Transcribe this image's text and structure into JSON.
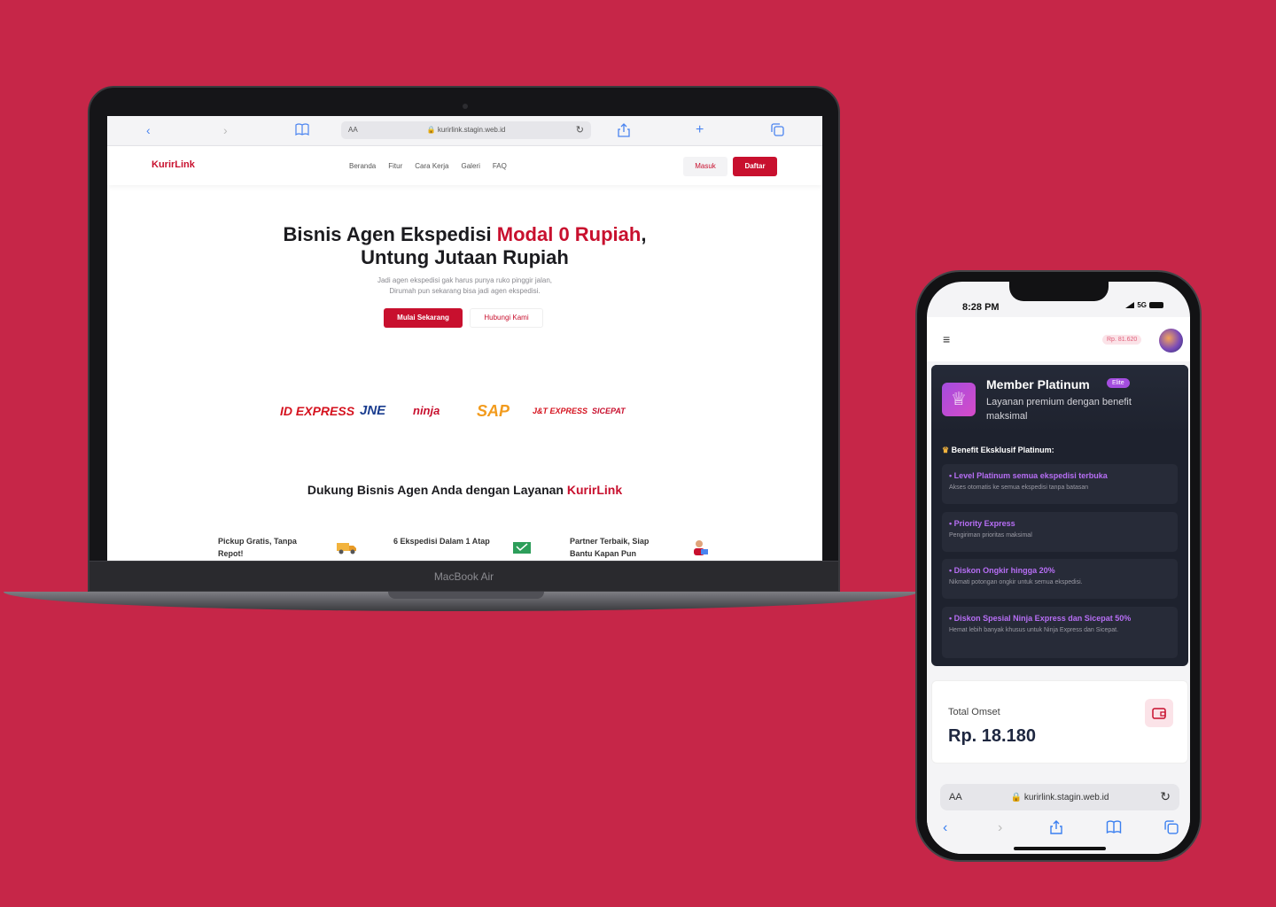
{
  "laptop": {
    "model": "MacBook Air",
    "browser": {
      "aa": "AA",
      "url": "kurirlink.stagin.web.id"
    },
    "site": {
      "brand": "KurirLink",
      "nav": [
        "Beranda",
        "Fitur",
        "Cara Kerja",
        "Galeri",
        "FAQ"
      ],
      "login_label": "Masuk",
      "register_label": "Daftar",
      "hero": {
        "title_part1": "Bisnis Agen Ekspedisi ",
        "title_accent": "Modal 0 Rupiah",
        "title_part2": ",",
        "title_line2": "Untung Jutaan Rupiah",
        "subtitle_line1": "Jadi agen ekspedisi gak harus punya ruko pinggir jalan,",
        "subtitle_line2": "Dirumah pun sekarang bisa jadi agen ekspedisi.",
        "cta_primary": "Mulai Sekarang",
        "cta_secondary": "Hubungi Kami"
      },
      "partner_logos": [
        "ID EXPRESS",
        "JNE",
        "ninja",
        "SAP",
        "J&T EXPRESS",
        "SICEPAT"
      ],
      "section_title": "Dukung Bisnis Agen Anda dengan Layanan ",
      "section_title_accent": "KurirLink",
      "features": [
        {
          "line1": "Pickup Gratis, Tanpa",
          "line2": "Repot!"
        },
        {
          "line1": "6 Ekspedisi Dalam 1 Atap",
          "line2": ""
        },
        {
          "line1": "Partner Terbaik, Siap",
          "line2": "Bantu Kapan Pun"
        }
      ]
    }
  },
  "phone": {
    "status": {
      "time": "8:28 PM",
      "network": "5G"
    },
    "header": {
      "balance": "Rp. 81.620"
    },
    "member": {
      "title": "Member Platinum",
      "badge": "Elite",
      "subtitle": "Layanan premium dengan benefit maksimal",
      "benefits_heading": "Benefit Eksklusif Platinum:",
      "benefits": [
        {
          "title": "Level Platinum semua ekspedisi terbuka",
          "desc": "Akses otomatis ke semua ekspedisi tanpa batasan"
        },
        {
          "title": "Priority Express",
          "desc": "Pengiriman prioritas maksimal"
        },
        {
          "title": "Diskon Ongkir hingga 20%",
          "desc": "Nikmati potongan ongkir untuk semua ekspedisi."
        },
        {
          "title": "Diskon Spesial Ninja Express dan Sicepat 50%",
          "desc": "Hemat lebih banyak khusus untuk Ninja Express dan Sicepat."
        }
      ]
    },
    "omset": {
      "label": "Total Omset",
      "value": "Rp. 18.180"
    },
    "browser": {
      "aa": "AA",
      "url": "kurirlink.stagin.web.id"
    }
  },
  "colors": {
    "background": "#c62648",
    "brand": "#c8102e",
    "card_dark": "#1e222e",
    "purple": "#b76ef5"
  }
}
